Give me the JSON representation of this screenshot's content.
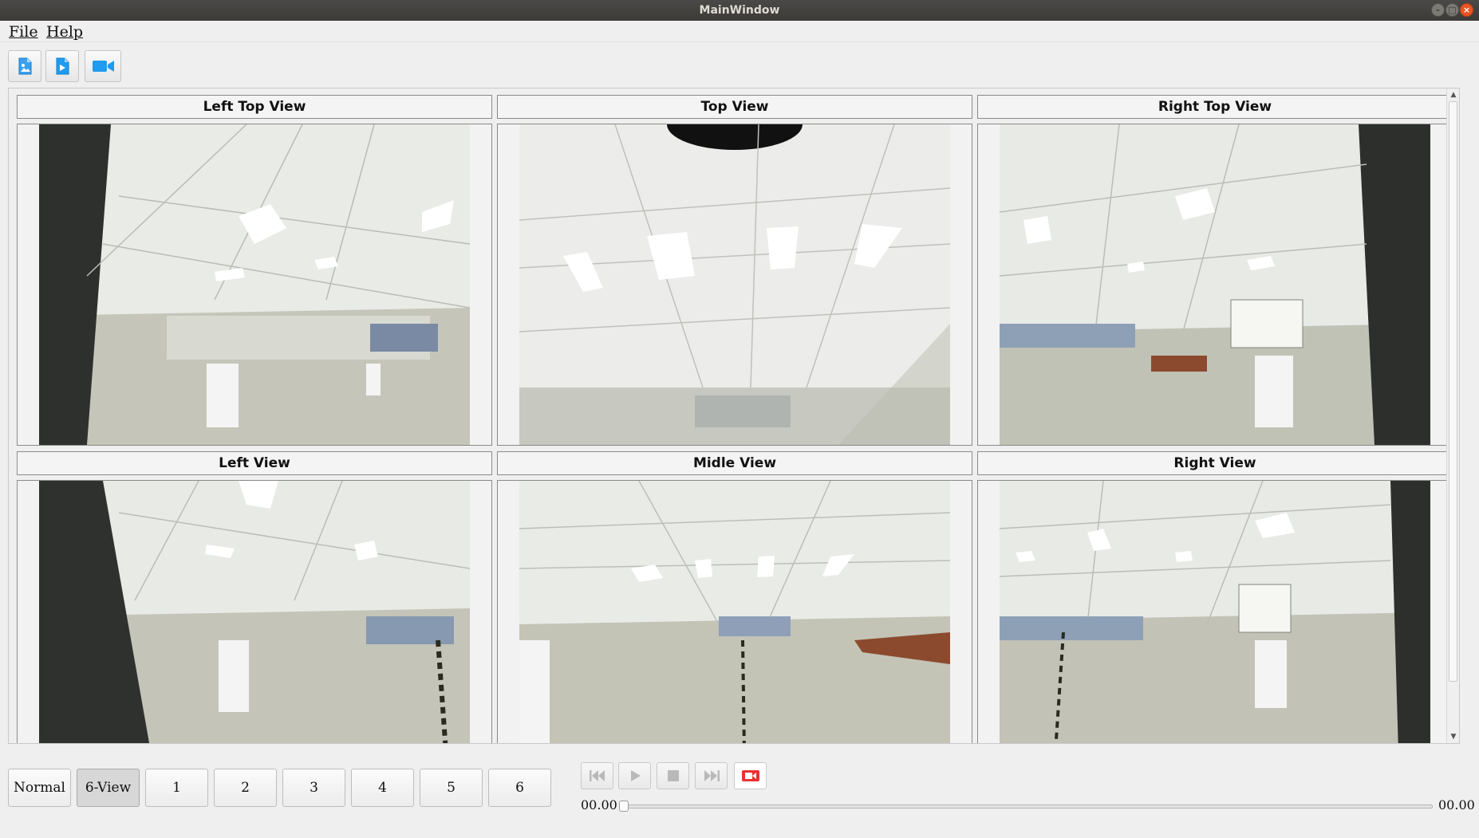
{
  "window": {
    "title": "MainWindow"
  },
  "menu": [
    {
      "label": "File"
    },
    {
      "label": "Help"
    }
  ],
  "toolbar": [
    {
      "icon": "open-image-icon"
    },
    {
      "icon": "open-video-icon"
    },
    {
      "icon": "camera-icon"
    }
  ],
  "views": [
    {
      "label": "Left Top View"
    },
    {
      "label": "Top View"
    },
    {
      "label": "Right Top View"
    },
    {
      "label": "Left View"
    },
    {
      "label": "Midle View"
    },
    {
      "label": "Right View"
    }
  ],
  "modes": [
    {
      "label": "Normal",
      "active": false
    },
    {
      "label": "6-View",
      "active": true
    },
    {
      "label": "1",
      "active": false
    },
    {
      "label": "2",
      "active": false
    },
    {
      "label": "3",
      "active": false
    },
    {
      "label": "4",
      "active": false
    },
    {
      "label": "5",
      "active": false
    },
    {
      "label": "6",
      "active": false
    }
  ],
  "player": {
    "controls": [
      "skip-back-icon",
      "play-icon",
      "stop-icon",
      "skip-forward-icon",
      "record-icon"
    ],
    "current_time": "00.00",
    "total_time": "00.00",
    "position": 0
  },
  "colors": {
    "record": "#e8322f",
    "accent": "#1f9bf0"
  }
}
